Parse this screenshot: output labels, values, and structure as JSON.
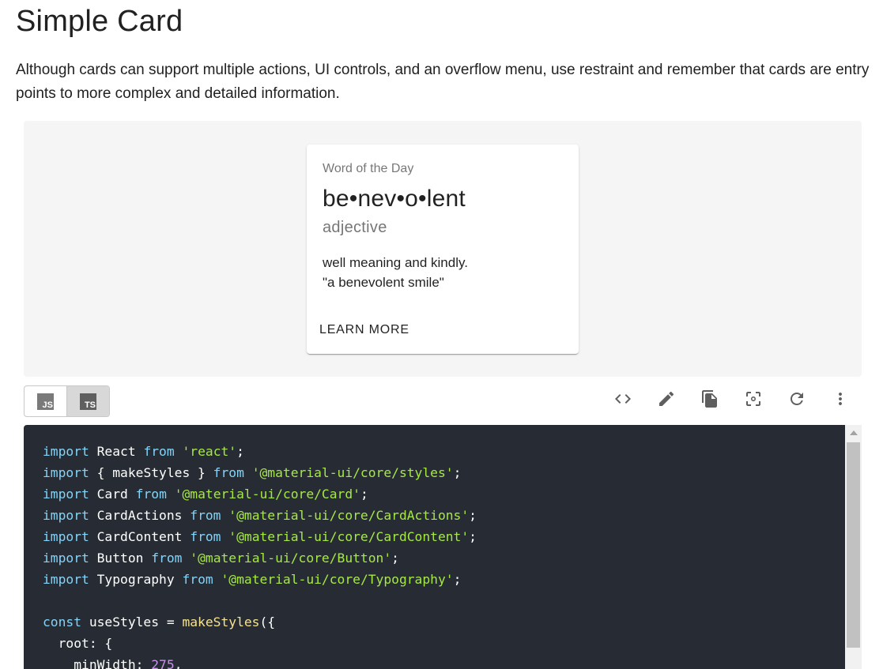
{
  "page": {
    "title": "Simple Card",
    "description": "Although cards can support multiple actions, UI controls, and an overflow menu, use restraint and remember that cards are entry points to more complex and detailed information."
  },
  "card": {
    "overline": "Word of the Day",
    "word": "be•nev•o•lent",
    "part_of_speech": "adjective",
    "definition": "well meaning and kindly.",
    "example": "\"a benevolent smile\"",
    "action_label": "LEARN MORE"
  },
  "lang_toggle": [
    {
      "label": "JS",
      "selected": false
    },
    {
      "label": "TS",
      "selected": true
    }
  ],
  "toolbar_icons": [
    "code-icon",
    "edit-icon",
    "copy-icon",
    "screenshot-icon",
    "reset-icon",
    "more-vert-icon"
  ],
  "code": {
    "lines": [
      [
        [
          "kw",
          "import"
        ],
        [
          "t",
          " React "
        ],
        [
          "kw",
          "from"
        ],
        [
          "t",
          " "
        ],
        [
          "str",
          "'react'"
        ],
        [
          "t",
          ";"
        ]
      ],
      [
        [
          "kw",
          "import"
        ],
        [
          "t",
          " { makeStyles } "
        ],
        [
          "kw",
          "from"
        ],
        [
          "t",
          " "
        ],
        [
          "str",
          "'@material-ui/core/styles'"
        ],
        [
          "t",
          ";"
        ]
      ],
      [
        [
          "kw",
          "import"
        ],
        [
          "t",
          " Card "
        ],
        [
          "kw",
          "from"
        ],
        [
          "t",
          " "
        ],
        [
          "str",
          "'@material-ui/core/Card'"
        ],
        [
          "t",
          ";"
        ]
      ],
      [
        [
          "kw",
          "import"
        ],
        [
          "t",
          " CardActions "
        ],
        [
          "kw",
          "from"
        ],
        [
          "t",
          " "
        ],
        [
          "str",
          "'@material-ui/core/CardActions'"
        ],
        [
          "t",
          ";"
        ]
      ],
      [
        [
          "kw",
          "import"
        ],
        [
          "t",
          " CardContent "
        ],
        [
          "kw",
          "from"
        ],
        [
          "t",
          " "
        ],
        [
          "str",
          "'@material-ui/core/CardContent'"
        ],
        [
          "t",
          ";"
        ]
      ],
      [
        [
          "kw",
          "import"
        ],
        [
          "t",
          " Button "
        ],
        [
          "kw",
          "from"
        ],
        [
          "t",
          " "
        ],
        [
          "str",
          "'@material-ui/core/Button'"
        ],
        [
          "t",
          ";"
        ]
      ],
      [
        [
          "kw",
          "import"
        ],
        [
          "t",
          " Typography "
        ],
        [
          "kw",
          "from"
        ],
        [
          "t",
          " "
        ],
        [
          "str",
          "'@material-ui/core/Typography'"
        ],
        [
          "t",
          ";"
        ]
      ],
      [],
      [
        [
          "kw",
          "const"
        ],
        [
          "t",
          " useStyles = "
        ],
        [
          "fn",
          "makeStyles"
        ],
        [
          "t",
          "({"
        ]
      ],
      [
        [
          "t",
          "  root: {"
        ]
      ],
      [
        [
          "t",
          "    minWidth: "
        ],
        [
          "num",
          "275"
        ],
        [
          "t",
          ","
        ]
      ]
    ]
  }
}
